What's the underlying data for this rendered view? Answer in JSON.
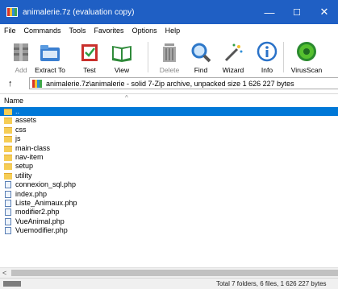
{
  "window": {
    "title": "animalerie.7z (evaluation copy)",
    "controls": {
      "minimize": "—",
      "maximize": "☐",
      "close": "✕"
    }
  },
  "menu": [
    "File",
    "Commands",
    "Tools",
    "Favorites",
    "Options",
    "Help"
  ],
  "toolbar": [
    {
      "label": "Add",
      "icon": "add-icon",
      "disabled": true
    },
    {
      "label": "Extract To",
      "icon": "extract-icon",
      "disabled": false
    },
    {
      "label": "Test",
      "icon": "test-icon",
      "disabled": false
    },
    {
      "label": "View",
      "icon": "view-icon",
      "disabled": false
    },
    {
      "label": "Delete",
      "icon": "delete-icon",
      "disabled": true
    },
    {
      "label": "Find",
      "icon": "find-icon",
      "disabled": false
    },
    {
      "label": "Wizard",
      "icon": "wizard-icon",
      "disabled": false
    },
    {
      "label": "Info",
      "icon": "info-icon",
      "disabled": false
    },
    {
      "label": "VirusScan",
      "icon": "virusscan-icon",
      "disabled": false
    }
  ],
  "address": {
    "up_icon": "↑",
    "path": "animalerie.7z\\animalerie - solid 7-Zip archive, unpacked size 1 626 227 bytes"
  },
  "list": {
    "column_name": "Name",
    "sort_indicator": "^",
    "rows": [
      {
        "name": "..",
        "type": "folder",
        "selected": true
      },
      {
        "name": "assets",
        "type": "folder"
      },
      {
        "name": "css",
        "type": "folder"
      },
      {
        "name": "js",
        "type": "folder"
      },
      {
        "name": "main-class",
        "type": "folder"
      },
      {
        "name": "nav-item",
        "type": "folder"
      },
      {
        "name": "setup",
        "type": "folder"
      },
      {
        "name": "utility",
        "type": "folder"
      },
      {
        "name": "connexion_sql.php",
        "type": "file"
      },
      {
        "name": "index.php",
        "type": "file"
      },
      {
        "name": "Liste_Animaux.php",
        "type": "file"
      },
      {
        "name": "modifier2.php",
        "type": "file"
      },
      {
        "name": "VueAnimal.php",
        "type": "file"
      },
      {
        "name": "Vuemodifier.php",
        "type": "file"
      }
    ]
  },
  "scrollbar": {
    "left_arrow": "<"
  },
  "status": {
    "text": "Total 7 folders, 6 files, 1 626 227 bytes"
  },
  "colors": {
    "titlebar": "#1f5fc4",
    "selection": "#0078d7"
  }
}
